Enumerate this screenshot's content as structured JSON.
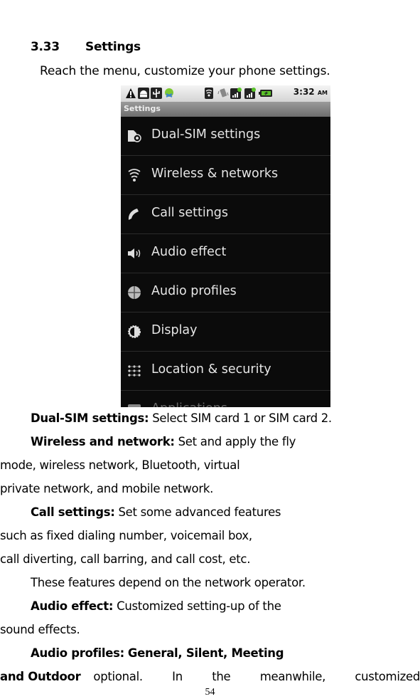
{
  "section": {
    "number": "3.33",
    "title": "Settings"
  },
  "intro": "Reach the menu, customize your phone settings.",
  "phone": {
    "status_bar": {
      "icons": [
        "warning-icon",
        "android-icon",
        "usb-icon",
        "android-debug-icon",
        "wifi-icon",
        "vibrate-icon",
        "signal-sim1-icon",
        "signal-sim2-icon",
        "battery-icon"
      ],
      "time": "3:32",
      "ampm": "AM"
    },
    "title": "Settings",
    "items": [
      {
        "label": "Dual-SIM settings",
        "icon": "sim-settings-icon"
      },
      {
        "label": "Wireless & networks",
        "icon": "wireless-icon"
      },
      {
        "label": "Call settings",
        "icon": "phone-icon"
      },
      {
        "label": "Audio effect",
        "icon": "speaker-icon"
      },
      {
        "label": "Audio profiles",
        "icon": "profiles-icon"
      },
      {
        "label": "Display",
        "icon": "brightness-icon"
      },
      {
        "label": "Location & security",
        "icon": "location-grid-icon"
      },
      {
        "label": "Applications",
        "icon": "applications-icon"
      }
    ]
  },
  "body": {
    "dual_sim": {
      "term": "Dual-SIM settings:",
      "text": "Select SIM card 1 or SIM card 2."
    },
    "wireless": {
      "term": "Wireless and network:",
      "text": "Set and apply the fly",
      "cont": [
        "mode, wireless network, Bluetooth, virtual",
        "private network, and mobile network."
      ]
    },
    "call": {
      "term": "Call settings:",
      "text": "Set some advanced features",
      "cont": [
        "such as fixed dialing number, voicemail box,",
        "call diverting, call barring, and call cost, etc."
      ]
    },
    "network_note": "These features depend on the network operator.",
    "audio_effect": {
      "term": "Audio effect:",
      "text": "Customized setting-up of the",
      "cont": [
        "sound effects."
      ]
    },
    "audio_profiles": {
      "term": "Audio profiles:",
      "text_bold": "General, Silent, Meeting",
      "cont_bold": "and Outdoor",
      "cont_text": "optional. In the meanwhile, customized"
    }
  },
  "page_number": "54"
}
